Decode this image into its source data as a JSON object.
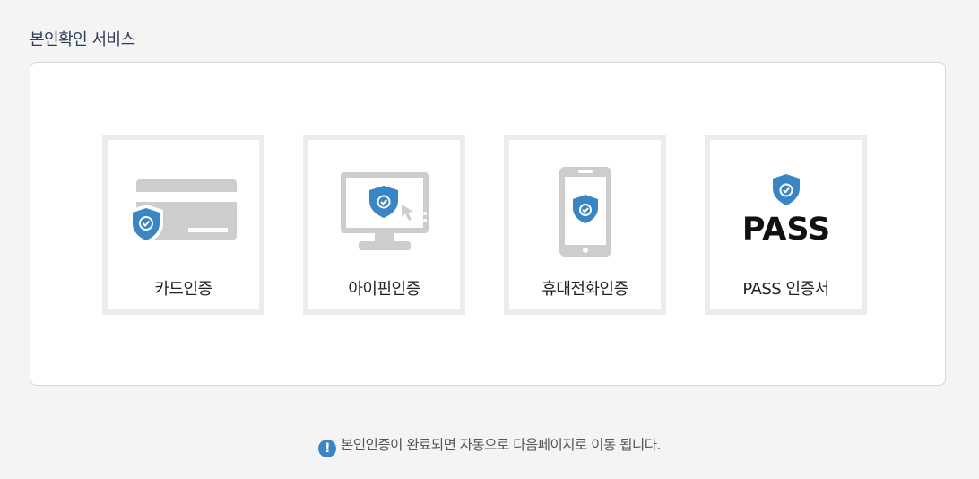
{
  "section": {
    "title": "본인확인 서비스"
  },
  "options": [
    {
      "id": "card",
      "label": "카드인증",
      "icon": "credit-card-shield-icon"
    },
    {
      "id": "ipin",
      "label": "아이핀인증",
      "icon": "monitor-shield-cursor-icon"
    },
    {
      "id": "phone",
      "label": "휴대전화인증",
      "icon": "smartphone-shield-icon"
    },
    {
      "id": "pass",
      "label": "PASS 인증서",
      "icon": "pass-logo-shield-icon",
      "logo_text": "PASS"
    }
  ],
  "notice": {
    "icon": "exclamation-circle-icon",
    "icon_glyph": "!",
    "text": "본인인증이 완료되면 자동으로 다음페이지로 이동 됩니다."
  },
  "colors": {
    "shield_blue": "#3a86c4",
    "icon_gray": "#cdcdcd",
    "card_border": "#ececec",
    "title_navy": "#2b3e56"
  }
}
